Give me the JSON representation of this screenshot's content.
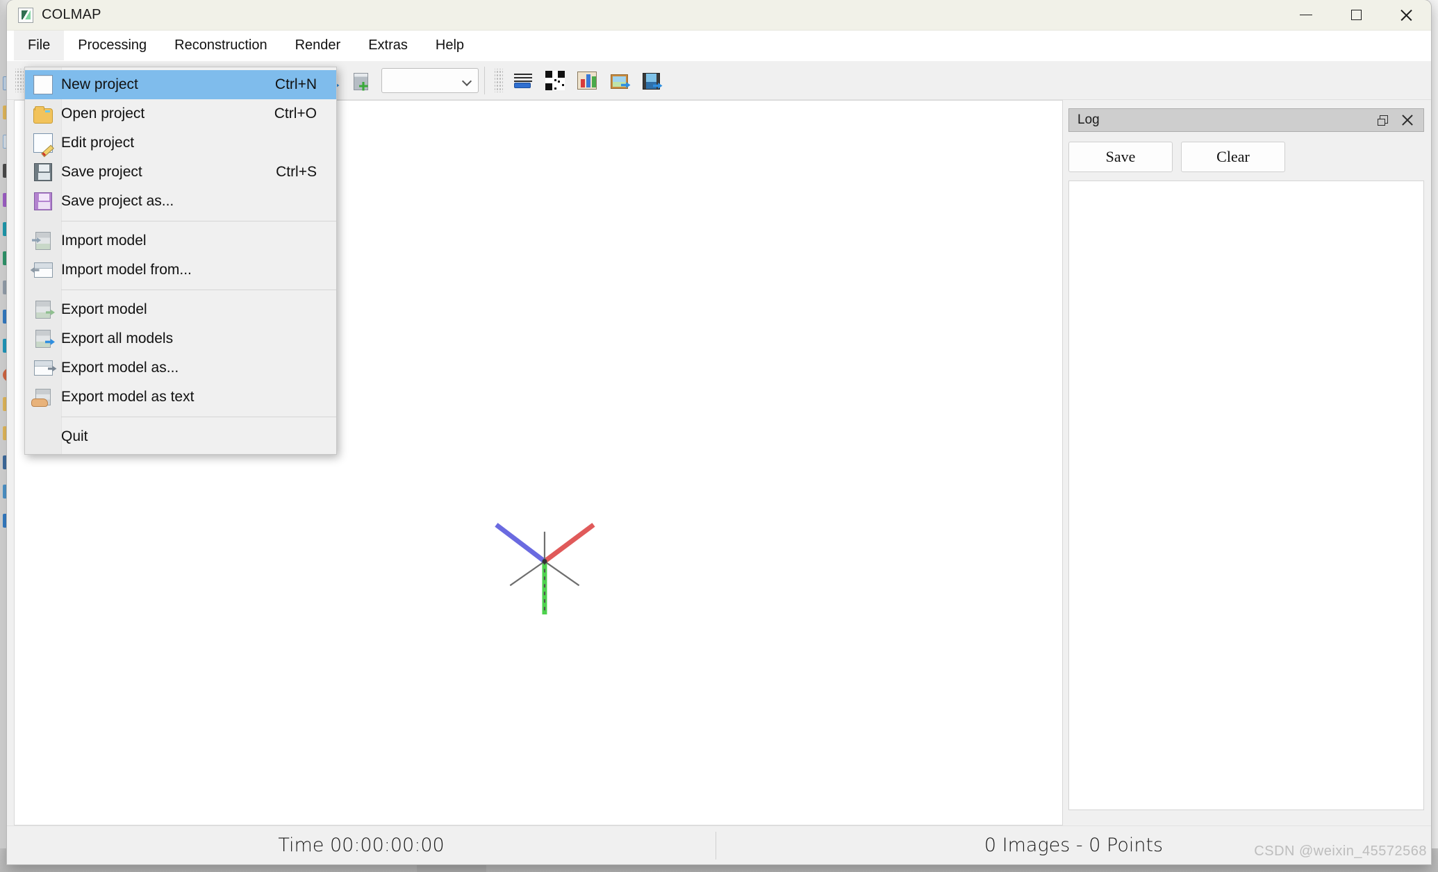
{
  "window": {
    "title": "COLMAP",
    "icon": "colmap-app-icon",
    "controls": {
      "minimize": "minimize-icon",
      "maximize": "maximize-icon",
      "close": "close-icon"
    }
  },
  "menu_bar": {
    "items": [
      {
        "label": "File",
        "open": true
      },
      {
        "label": "Processing",
        "open": false
      },
      {
        "label": "Reconstruction",
        "open": false
      },
      {
        "label": "Render",
        "open": false
      },
      {
        "label": "Extras",
        "open": false
      },
      {
        "label": "Help",
        "open": false
      }
    ]
  },
  "file_menu": {
    "groups": [
      {
        "items": [
          {
            "label": "New project",
            "shortcut": "Ctrl+N",
            "icon": "new-page-icon",
            "selected": true
          },
          {
            "label": "Open project",
            "shortcut": "Ctrl+O",
            "icon": "open-folder-icon",
            "selected": false
          },
          {
            "label": "Edit project",
            "shortcut": "",
            "icon": "edit-page-icon",
            "selected": false
          },
          {
            "label": "Save project",
            "shortcut": "Ctrl+S",
            "icon": "save-disk-icon",
            "selected": false
          },
          {
            "label": "Save project as...",
            "shortcut": "",
            "icon": "save-as-disk-icon",
            "selected": false
          }
        ]
      },
      {
        "items": [
          {
            "label": "Import model",
            "shortcut": "",
            "icon": "import-model-icon",
            "selected": false
          },
          {
            "label": "Import model from...",
            "shortcut": "",
            "icon": "import-model-from-icon",
            "selected": false
          }
        ]
      },
      {
        "items": [
          {
            "label": "Export model",
            "shortcut": "",
            "icon": "export-model-icon",
            "selected": false
          },
          {
            "label": "Export all models",
            "shortcut": "",
            "icon": "export-all-models-icon",
            "selected": false
          },
          {
            "label": "Export model as...",
            "shortcut": "",
            "icon": "export-model-as-icon",
            "selected": false
          },
          {
            "label": "Export model as text",
            "shortcut": "",
            "icon": "export-model-as-text-icon",
            "selected": false
          }
        ]
      },
      {
        "items": [
          {
            "label": "Quit",
            "shortcut": "",
            "icon": "",
            "selected": false
          }
        ]
      }
    ]
  },
  "toolbar": {
    "buttons": [
      {
        "name": "feature-matching-icon"
      },
      {
        "name": "reconstruction-start-icon"
      },
      {
        "name": "reconstruction-step-icon"
      },
      {
        "name": "reconstruction-pause-icon"
      },
      {
        "name": "reconstruction-options-icon"
      },
      {
        "name": "bundle-adjustment-icon"
      },
      {
        "name": "dense-reconstruction-icon"
      },
      {
        "name": "model-add-icon"
      },
      {
        "name": "model-next-icon"
      },
      {
        "name": "model-merge-icon"
      },
      {
        "name": "model-statistics-icon"
      },
      {
        "name": "match-matrix-icon"
      },
      {
        "name": "model-chart-icon"
      },
      {
        "name": "undistort-image-icon"
      },
      {
        "name": "render-video-icon"
      }
    ],
    "model_selector": {
      "value": "",
      "placeholder": ""
    }
  },
  "log_panel": {
    "title": "Log",
    "float_icon": "undock-icon",
    "close_icon": "close-icon",
    "save_label": "Save",
    "clear_label": "Clear",
    "content": ""
  },
  "viewport": {
    "axes": [
      {
        "name": "x-axis",
        "color": "#e05a5a"
      },
      {
        "name": "y-axis",
        "color": "#4ed24e"
      },
      {
        "name": "z-axis",
        "color": "#6a6ae0"
      },
      {
        "name": "grid-axis",
        "color": "#6e6e6e"
      }
    ]
  },
  "status_bar": {
    "time": "Time 00:00:00:00",
    "counts": "0 Images - 0 Points"
  },
  "watermark": "CSDN @weixin_45572568",
  "colors": {
    "title_bar": "#f1f1e8",
    "menu_highlight": "#7fbcec",
    "toolbar_bg": "#f0f0f0",
    "dock_header": "#cecece",
    "viewport_bg": "#ffffff"
  }
}
